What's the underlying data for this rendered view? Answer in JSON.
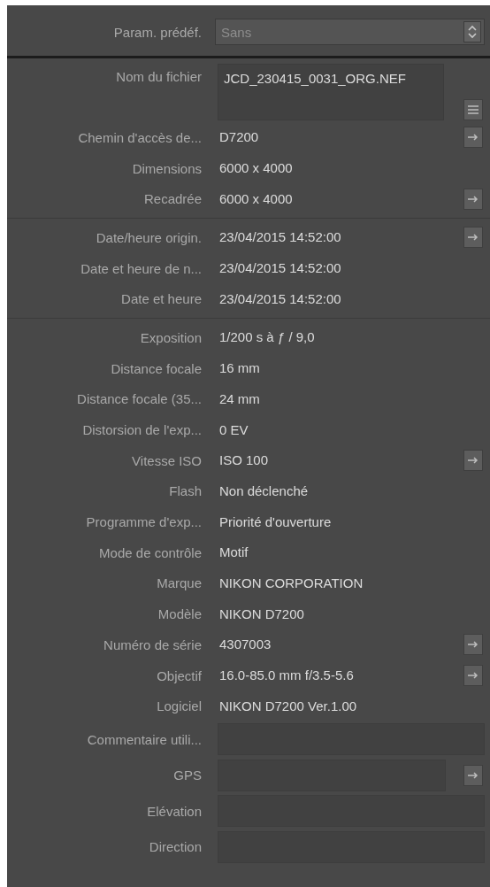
{
  "preset": {
    "label": "Param. prédéf.",
    "value": "Sans"
  },
  "sections": [
    {
      "rows": [
        {
          "label": "Nom du fichier",
          "kind": "multiline",
          "value": "JCD_230415_0031_ORG.NEF",
          "button": {
            "kind": "list"
          }
        },
        {
          "label": "Chemin d'accès de...",
          "kind": "text",
          "value": "D7200",
          "button": {
            "kind": "arrow"
          }
        },
        {
          "label": "Dimensions",
          "kind": "text",
          "value": "6000 x 4000"
        },
        {
          "label": "Recadrée",
          "kind": "text",
          "value": "6000 x 4000",
          "button": {
            "kind": "arrow"
          }
        }
      ]
    },
    {
      "rows": [
        {
          "label": "Date/heure origin.",
          "kind": "text",
          "value": "23/04/2015 14:52:00",
          "button": {
            "kind": "arrow"
          }
        },
        {
          "label": "Date et heure de n...",
          "kind": "text",
          "value": "23/04/2015 14:52:00"
        },
        {
          "label": "Date et heure",
          "kind": "text",
          "value": "23/04/2015 14:52:00"
        }
      ]
    },
    {
      "rows": [
        {
          "label": "Exposition",
          "kind": "text",
          "value": "1/200 s à ƒ / 9,0"
        },
        {
          "label": "Distance focale",
          "kind": "text",
          "value": "16 mm"
        },
        {
          "label": "Distance focale (35...",
          "kind": "text",
          "value": "24 mm"
        },
        {
          "label": "Distorsion de l'exp...",
          "kind": "text",
          "value": "0 EV"
        },
        {
          "label": "Vitesse ISO",
          "kind": "text",
          "value": "ISO 100",
          "button": {
            "kind": "arrow"
          }
        },
        {
          "label": "Flash",
          "kind": "text",
          "value": "Non déclenché"
        },
        {
          "label": "Programme d'exp...",
          "kind": "text",
          "value": "Priorité d'ouverture"
        },
        {
          "label": "Mode de contrôle",
          "kind": "text",
          "value": "Motif"
        },
        {
          "label": "Marque",
          "kind": "text",
          "value": "NIKON CORPORATION"
        },
        {
          "label": "Modèle",
          "kind": "text",
          "value": "NIKON D7200"
        },
        {
          "label": "Numéro de série",
          "kind": "text",
          "value": "4307003",
          "button": {
            "kind": "arrow"
          }
        },
        {
          "label": "Objectif",
          "kind": "text",
          "value": "16.0-85.0 mm f/3.5-5.6",
          "button": {
            "kind": "arrow"
          }
        },
        {
          "label": "Logiciel",
          "kind": "text",
          "value": "NIKON D7200 Ver.1.00"
        },
        {
          "label": "Commentaire utili...",
          "kind": "field"
        },
        {
          "label": "GPS",
          "kind": "field",
          "button": {
            "kind": "arrow"
          }
        },
        {
          "label": "Elévation",
          "kind": "field"
        },
        {
          "label": "Direction",
          "kind": "field"
        }
      ]
    }
  ]
}
